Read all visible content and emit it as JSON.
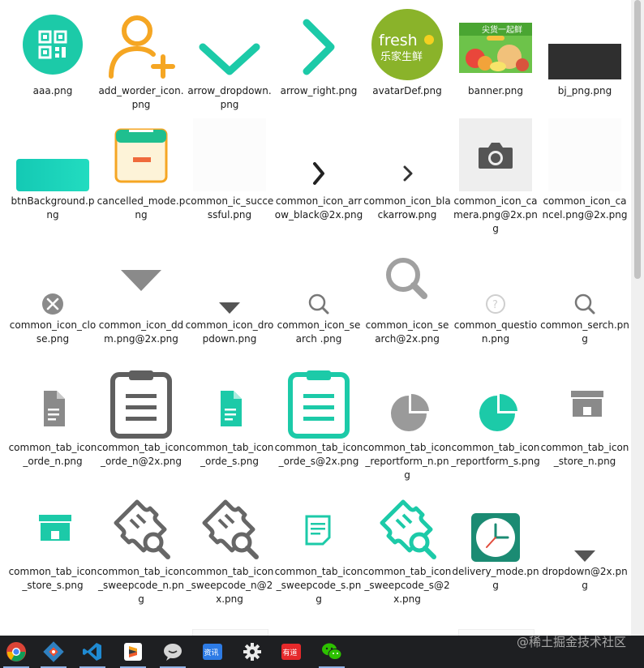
{
  "files": [
    {
      "label": "aaa.png",
      "icon": "qr-code-icon"
    },
    {
      "label": "add_worder_icon.png",
      "icon": "add-user-icon"
    },
    {
      "label": "arrow_dropdown.png",
      "icon": "chevron-down-icon"
    },
    {
      "label": "arrow_right.png",
      "icon": "chevron-right-icon"
    },
    {
      "label": "avatarDef.png",
      "icon": "fresh-logo-icon",
      "logo_text": "fresh",
      "logo_sub": "乐家生鲜"
    },
    {
      "label": "banner.png",
      "icon": "banner-image-icon",
      "banner_text": "尖货一起鲜"
    },
    {
      "label": "bj_png.png",
      "icon": "dark-bar-icon"
    },
    {
      "label": "btnBackground.png",
      "icon": "gradient-button-icon"
    },
    {
      "label": "cancelled_mode.png",
      "icon": "calendar-cancel-icon"
    },
    {
      "label": "common_ic_successful.png",
      "icon": "blank-image-icon"
    },
    {
      "label": "common_icon_arrow_black@2x.png",
      "icon": "chevron-right-small-icon"
    },
    {
      "label": "common_icon_blackarrow.png",
      "icon": "chevron-right-tiny-icon"
    },
    {
      "label": "common_icon_camera.png@2x.png",
      "icon": "camera-icon"
    },
    {
      "label": "common_icon_cancel.png@2x.png",
      "icon": "blank-image-icon"
    },
    {
      "label": "common_icon_close.png",
      "icon": "close-circle-icon"
    },
    {
      "label": "common_icon_ddm.png@2x.png",
      "icon": "triangle-down-icon"
    },
    {
      "label": "common_icon_dropdown.png",
      "icon": "triangle-down-small-icon"
    },
    {
      "label": "common_icon_search .png",
      "icon": "search-small-icon"
    },
    {
      "label": "common_icon_search@2x.png",
      "icon": "search-icon"
    },
    {
      "label": "common_question.png",
      "icon": "question-icon"
    },
    {
      "label": "common_serch.png",
      "icon": "search-small-icon"
    },
    {
      "label": "common_tab_icon_orde_n.png",
      "icon": "document-gray-icon"
    },
    {
      "label": "common_tab_icon_orde_n@2x.png",
      "icon": "clipboard-gray-icon"
    },
    {
      "label": "common_tab_icon_orde_s.png",
      "icon": "document-teal-icon"
    },
    {
      "label": "common_tab_icon_orde_s@2x.png",
      "icon": "clipboard-teal-icon"
    },
    {
      "label": "common_tab_icon_reportform_n.png",
      "icon": "pie-chart-gray-icon"
    },
    {
      "label": "common_tab_icon_reportform_s.png",
      "icon": "pie-chart-teal-icon"
    },
    {
      "label": "common_tab_icon_store_n.png",
      "icon": "store-gray-icon"
    },
    {
      "label": "common_tab_icon_store_s.png",
      "icon": "store-teal-icon"
    },
    {
      "label": "common_tab_icon_sweepcode_n.png",
      "icon": "ticket-search-gray-icon"
    },
    {
      "label": "common_tab_icon_sweepcode_n@2x.png",
      "icon": "ticket-search-gray-icon"
    },
    {
      "label": "common_tab_icon_sweepcode_s.png",
      "icon": "note-teal-icon"
    },
    {
      "label": "common_tab_icon_sweepcode_s@2x.png",
      "icon": "ticket-search-teal-icon"
    },
    {
      "label": "delivery_mode.png",
      "icon": "clock-icon"
    },
    {
      "label": "dropdown@2x.png",
      "icon": "triangle-down-small-icon"
    }
  ],
  "taskbar": {
    "apps": [
      {
        "name": "chrome-app",
        "icon": "chrome-icon"
      },
      {
        "name": "git-app",
        "icon": "git-icon"
      },
      {
        "name": "vscode-app",
        "icon": "vscode-icon"
      },
      {
        "name": "sublime-app",
        "icon": "sublime-icon"
      },
      {
        "name": "chat-app",
        "icon": "chat-bubble-icon"
      },
      {
        "name": "news-app",
        "icon": "news-icon",
        "text": "资讯"
      },
      {
        "name": "settings-app",
        "icon": "gear-icon"
      },
      {
        "name": "youdao-app",
        "icon": "youdao-icon",
        "text": "有道"
      },
      {
        "name": "wechat-app",
        "icon": "wechat-icon"
      }
    ]
  },
  "watermark": "@稀土掘金技术社区",
  "colors": {
    "teal": "#1ccaa8",
    "gray": "#8a8a8a",
    "orange": "#f5a623",
    "green": "#8ab32a",
    "taskbar": "#1e1f22"
  }
}
